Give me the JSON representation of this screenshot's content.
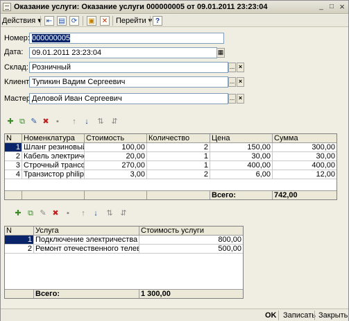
{
  "window": {
    "title": "Оказание услуги: Оказание услуги 000000005 от 09.01.2011 23:23:04",
    "minimize_glyph": "_",
    "maximize_glyph": "□",
    "close_glyph": "×"
  },
  "toolbar": {
    "actions_label": "Действия",
    "goto_label": "Перейти",
    "help_glyph": "?",
    "dropdown_glyph": "▾"
  },
  "form": {
    "number_label": "Номер:",
    "number_value": "000000005",
    "date_label": "Дата:",
    "date_value": "09.01.2011 23:23:04",
    "warehouse_label": "Склад:",
    "warehouse_value": "Розничный",
    "client_label": "Клиент:",
    "client_value": "Тупикин Вадим Сергеевич",
    "master_label": "Мастер",
    "master_value": "Деловой Иван Сергеевич",
    "select_glyph": "...",
    "clear_glyph": "×"
  },
  "goods_table": {
    "headers": [
      "N",
      "Номенклатура",
      "Стоимость",
      "Количество",
      "Цена",
      "Сумма"
    ],
    "rows": [
      [
        "1",
        "Шланг резиновый...",
        "100,00",
        "2",
        "150,00",
        "300,00"
      ],
      [
        "2",
        "Кабель электриче...",
        "20,00",
        "1",
        "30,00",
        "30,00"
      ],
      [
        "3",
        "Строчный трансфо...",
        "270,00",
        "1",
        "400,00",
        "400,00"
      ],
      [
        "4",
        "Транзистор philips ...",
        "3,00",
        "2",
        "6,00",
        "12,00"
      ]
    ],
    "total_label": "Всего:",
    "total_value": "742,00"
  },
  "services_table": {
    "headers": [
      "N",
      "Услуга",
      "Стоимость услуги"
    ],
    "rows": [
      [
        "1",
        "Подключение электричества",
        "800,00"
      ],
      [
        "2",
        "Ремонт отечественного телевиз...",
        "500,00"
      ]
    ],
    "total_label": "Всего:",
    "total_value": "1 300,00"
  },
  "statusbar": {
    "ok_label": "OK",
    "save_label": "Записать",
    "close_label": "Закрыть"
  }
}
